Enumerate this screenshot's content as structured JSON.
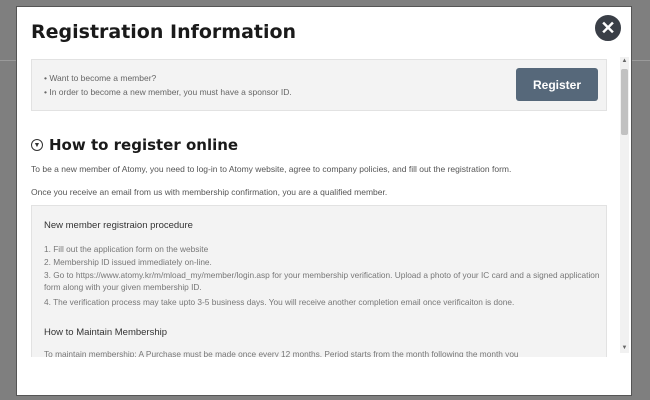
{
  "modal": {
    "title": "Registration Information",
    "close_symbol": "✕"
  },
  "notice": {
    "line1": "• Want to become a member?",
    "line2": "• In order to become a new member, you must have a sponsor ID.",
    "register_label": "Register"
  },
  "section": {
    "title": "How to register online",
    "para1": "To be a new member of Atomy, you need to log-in to Atomy website, agree to company policies, and fill out the registration form.",
    "para2": "Once you receive an email from us with membership confirmation, you are a qualified member."
  },
  "procedure": {
    "title": "New member registraion procedure",
    "steps": [
      "1. Fill out the application form on the website",
      "2. Membership ID issued immediately on-line.",
      "3. Go to https://www.atomy.kr/m/mload_my/member/login.asp for your membership verification. Upload a photo of your IC card and a signed application form along with your given membership ID.",
      "4. The verification process may take upto 3-5 business days. You will receive another completion email once verificaiton is done."
    ],
    "maintain_title": "How to Maintain Membership",
    "maintain_text": "To maintain membership: A Purchase must be made once every 12 months. Period starts from the month following the month you"
  },
  "icons": {
    "close": "close-icon",
    "section": "chevron-down-circle-icon"
  },
  "colors": {
    "register_button": "#56687a",
    "close_button": "#3a3f47"
  }
}
